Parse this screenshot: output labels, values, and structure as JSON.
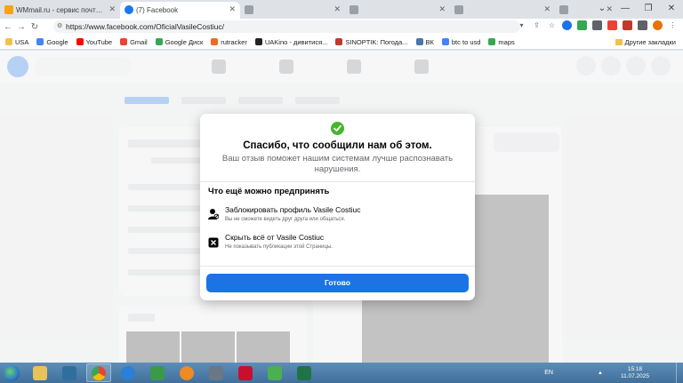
{
  "browser": {
    "tabs": [
      {
        "title": "WMmail.ru - сервис почтовых ра...",
        "color": "#f7a21b"
      },
      {
        "title": "(7) Facebook",
        "color": "#1877f2",
        "active": true
      },
      {
        "title": "",
        "color": "#9aa0a6"
      },
      {
        "title": "",
        "color": "#9aa0a6"
      },
      {
        "title": "",
        "color": "#9aa0a6"
      },
      {
        "title": "",
        "color": "#9aa0a6"
      }
    ],
    "address": "https://www.facebook.com/OficialVasileCostiuc/",
    "bookmarks": [
      {
        "label": "USA",
        "color": "#f0c24b"
      },
      {
        "label": "Google",
        "color": "#4285f4"
      },
      {
        "label": "YouTube",
        "color": "#ff0000"
      },
      {
        "label": "Gmail",
        "color": "#ea4335"
      },
      {
        "label": "Google Диск",
        "color": "#34a853"
      },
      {
        "label": "rutracker",
        "color": "#f26a22"
      },
      {
        "label": "UAKino - дивитися...",
        "color": "#222222"
      },
      {
        "label": "SINOPTIK: Погода...",
        "color": "#c0392b"
      },
      {
        "label": "ВК",
        "color": "#4a76a8"
      },
      {
        "label": "btc to usd",
        "color": "#4285f4"
      },
      {
        "label": "maps",
        "color": "#34a853"
      }
    ],
    "other_bookmarks": "Другие закладки"
  },
  "modal": {
    "title": "Спасибо, что сообщили нам об этом.",
    "subtitle": "Ваш отзыв поможет нашим системам лучше распознавать нарушения.",
    "section_title": "Что ещё можно предпринять",
    "options": [
      {
        "title": "Заблокировать профиль Vasile Costiuc",
        "desc": "Вы не сможете видеть друг друга или общаться.",
        "icon": "block-user-icon"
      },
      {
        "title": "Скрыть всё от Vasile Costiuc",
        "desc": "Не показывать публикации этой Страницы.",
        "icon": "hide-icon"
      }
    ],
    "done_label": "Готово"
  },
  "taskbar": {
    "lang": "EN",
    "time": "15:18",
    "date": "11.07.2025",
    "apps": [
      {
        "name": "file-explorer",
        "color": "#e8c35a"
      },
      {
        "name": "winamp",
        "color": "#2f6f9e"
      },
      {
        "name": "chrome",
        "color": "#34a853"
      },
      {
        "name": "ie-like-app",
        "color": "#2b7fd6"
      },
      {
        "name": "task-manager",
        "color": "#3a9a48"
      },
      {
        "name": "media-player",
        "color": "#f08a24"
      },
      {
        "name": "shield-app",
        "color": "#6b7785"
      },
      {
        "name": "aida64",
        "color": "#c8102e"
      },
      {
        "name": "remote-desktop",
        "color": "#4caf50"
      },
      {
        "name": "excel",
        "color": "#217346"
      }
    ]
  }
}
